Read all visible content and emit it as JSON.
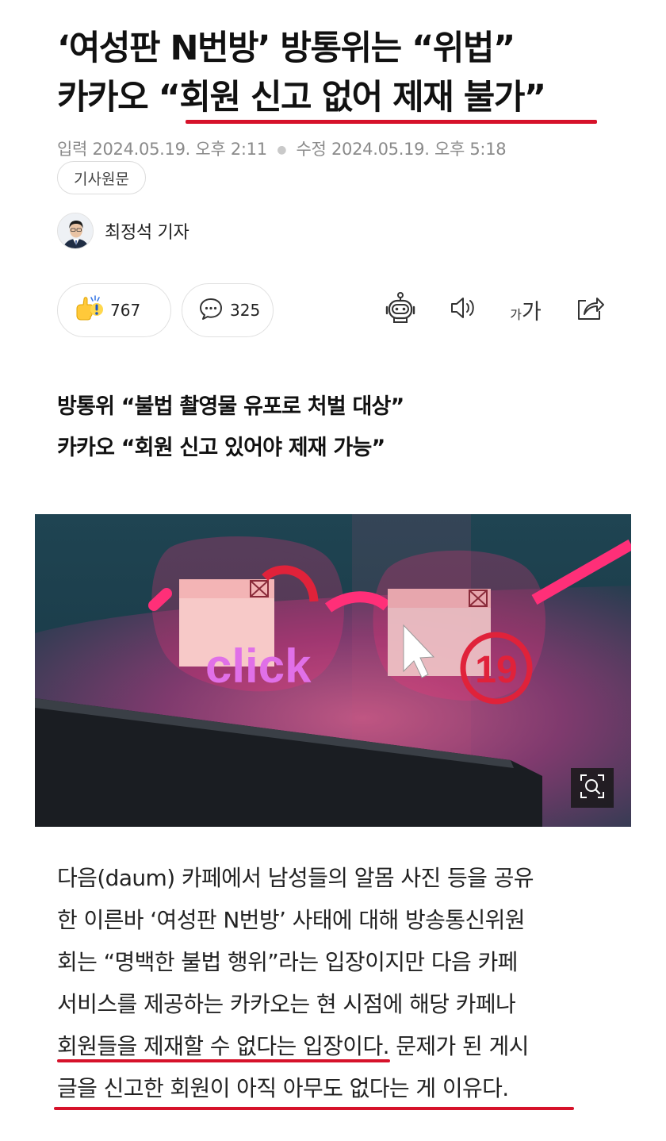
{
  "article": {
    "title_line1": "‘여성판 N번방’ 방통위는 “위법”",
    "title_line2": "카카오 “회원 신고 없어 제재 불가”",
    "meta": {
      "input_label": "입력",
      "input_time": "2024.05.19. 오후 2:11",
      "edit_label": "수정",
      "edit_time": "2024.05.19. 오후 5:18"
    },
    "source_button": "기사원문",
    "reporter": "최정석 기자",
    "reactions": {
      "like_count": "767",
      "comment_count": "325"
    },
    "toolbar": {
      "font_size_label_small": "가",
      "font_size_label_large": "가"
    },
    "subtitle_line1": "방통위 “불법 촬영물 유포로 처벌 대상”",
    "subtitle_line2": "카카오 “회원 신고 있어야 제재 가능”",
    "photo": {
      "text_click": "click",
      "text_19": "19"
    },
    "body_lines": [
      "다음(daum) 카페에서 남성들의 알몸 사진 등을 공유",
      "한 이른바 ‘여성판 N번방’ 사태에 대해 방송통신위원",
      "회는 “명백한 불법 행위”라는 입장이지만 다음 카페",
      "서비스를 제공하는 카카오는 현 시점에 해당 카페나",
      "회원들을 제재할 수 없다는 입장이다. 문제가 된 게시",
      "글을 신고한 회원이 아직 아무도 없다는 게 이유다."
    ]
  },
  "colors": {
    "underline": "#d6122a",
    "photo_bg": "#1a3a46",
    "glasses": "#ff2f78"
  },
  "icons": [
    "like-reaction-icon",
    "comment-icon",
    "ai-bot-icon",
    "speaker-icon",
    "share-icon",
    "zoom-icon"
  ]
}
